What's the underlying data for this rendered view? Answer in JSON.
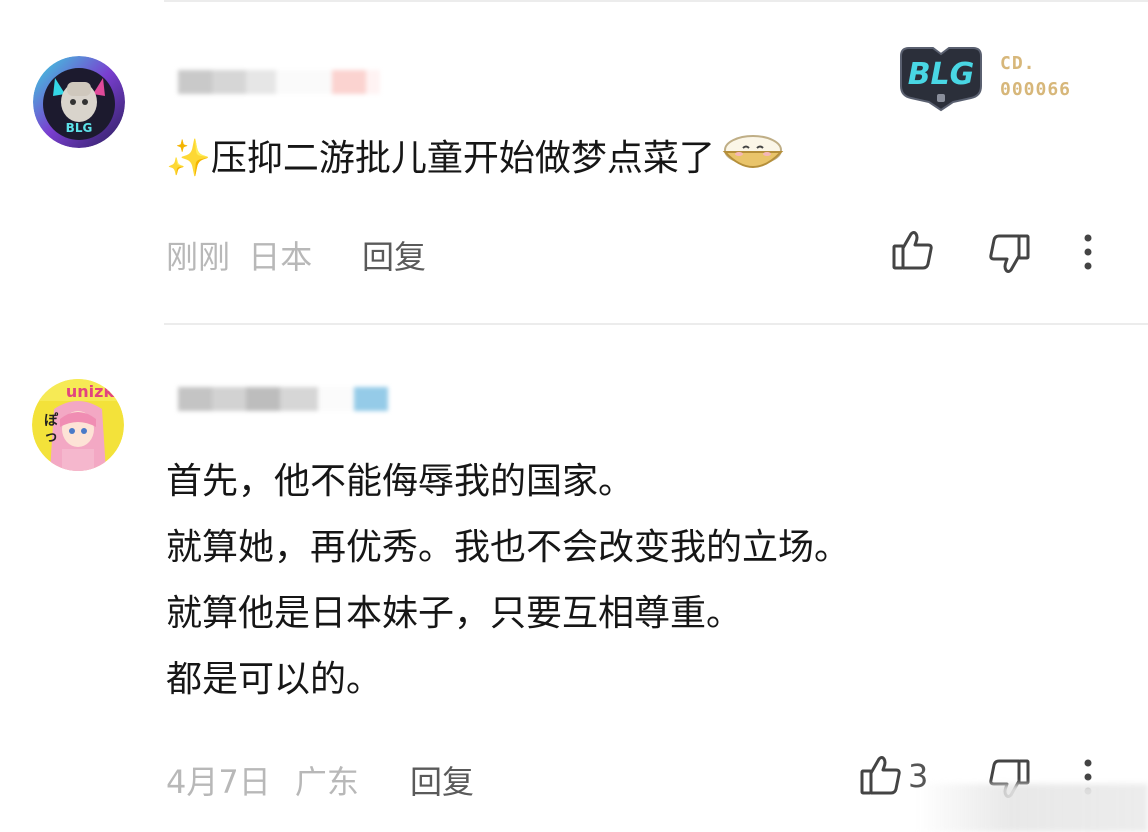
{
  "comments": [
    {
      "username": "",
      "badge_code_line1": "CD.",
      "badge_code_line2": "000066",
      "badge_logo_text": "BLG",
      "emoji_sparkle": "✨",
      "text": "压抑二游批儿童开始做梦点菜了",
      "time": "刚刚",
      "location": "日本",
      "reply_label": "回复",
      "like_count": ""
    },
    {
      "username": "",
      "lines": [
        "首先，他不能侮辱我的国家。",
        "就算她，再优秀。我也不会改变我的立场。",
        "就算他是日本妹子，只要互相尊重。",
        "都是可以的。"
      ],
      "time": "4月7日",
      "location": "广东",
      "reply_label": "回复",
      "like_count": "3"
    }
  ],
  "icons": {
    "like": "thumbs-up-icon",
    "dislike": "thumbs-down-icon",
    "more": "more-vertical-icon"
  },
  "colors": {
    "meta_gray": "#b8b8b8",
    "reply_gray": "#5a5a5a",
    "badge_gold": "#d7b77a",
    "divider": "#ececec"
  }
}
